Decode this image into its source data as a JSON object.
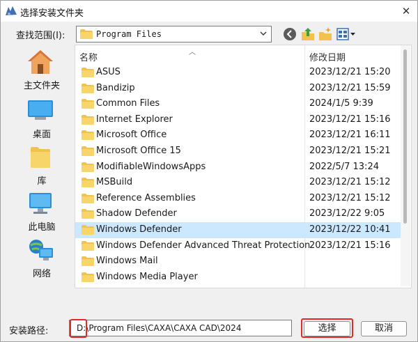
{
  "window": {
    "title": "选择安装文件夹",
    "close_glyph": "✕"
  },
  "lookin": {
    "label": "查找范围(I):",
    "value": "Program Files"
  },
  "toolbar": {
    "back": "back-icon",
    "up": "up-folder-icon",
    "new_folder": "new-folder-icon",
    "views": "views-menu-icon"
  },
  "places": [
    {
      "label": "主文件夹",
      "icon": "home-icon"
    },
    {
      "label": "桌面",
      "icon": "desktop-icon"
    },
    {
      "label": "库",
      "icon": "library-icon"
    },
    {
      "label": "此电脑",
      "icon": "computer-icon"
    },
    {
      "label": "网络",
      "icon": "network-icon"
    }
  ],
  "list": {
    "columns": {
      "name": "名称",
      "date": "修改日期"
    },
    "rows": [
      {
        "name": "ASUS",
        "date": "2023/12/21 15:20"
      },
      {
        "name": "Bandizip",
        "date": "2023/12/21 15:59"
      },
      {
        "name": "Common Files",
        "date": "2024/1/5 9:39"
      },
      {
        "name": "Internet Explorer",
        "date": "2023/12/21 15:16"
      },
      {
        "name": "Microsoft Office",
        "date": "2023/12/21 16:11"
      },
      {
        "name": "Microsoft Office 15",
        "date": "2023/12/21 15:21"
      },
      {
        "name": "ModifiableWindowsApps",
        "date": "2022/5/7 13:24"
      },
      {
        "name": "MSBuild",
        "date": "2023/12/21 15:12"
      },
      {
        "name": "Reference Assemblies",
        "date": "2023/12/21 15:12"
      },
      {
        "name": "Shadow Defender",
        "date": "2023/12/22 9:05"
      },
      {
        "name": "Windows Defender",
        "date": "2023/12/22 10:41",
        "selected": true
      },
      {
        "name": "Windows Defender Advanced Threat Protection",
        "date": "2023/12/21 15:16"
      },
      {
        "name": "Windows Mail",
        "date": ""
      },
      {
        "name": "Windows Media Player",
        "date": ""
      }
    ]
  },
  "install_path": {
    "label": "安装路径:",
    "drive": "D:",
    "value": "D:\\Program Files\\CAXA\\CAXA CAD\\2024"
  },
  "buttons": {
    "ok": "选择",
    "cancel": "取消"
  },
  "colors": {
    "selection": "#cce8ff",
    "highlight": "#e02a2a",
    "folder": "#f2c24f"
  }
}
